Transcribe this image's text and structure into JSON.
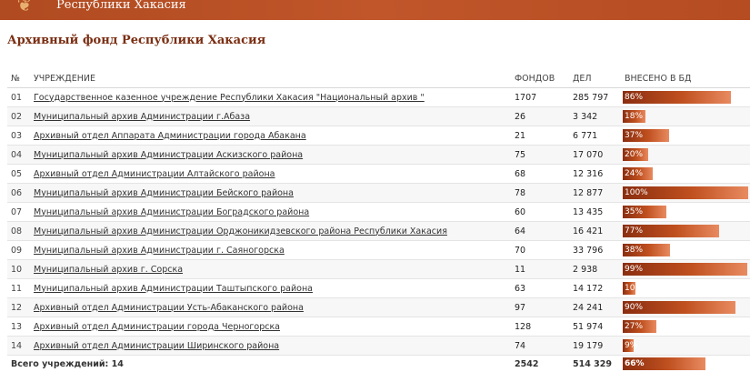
{
  "header": {
    "title": "Республики Хакасия",
    "logo_icon": "coat-of-arms-icon"
  },
  "page_title": "Архивный фонд Республики Хакасия",
  "table": {
    "columns": {
      "num": "№",
      "name": "УЧРЕЖДЕНИЕ",
      "funds": "ФОНДОВ",
      "cases": "ДЕЛ",
      "db": "ВНЕСЕНО В БД"
    },
    "rows": [
      {
        "num": "01",
        "name": "Государственное казенное учреждение Республики Хакасия \"Национальный архив \"",
        "funds": "1707",
        "cases": "285 797",
        "pct": "86%",
        "pct_value": 86
      },
      {
        "num": "02",
        "name": "Муниципальный архив Администрации г.Абаза",
        "funds": "26",
        "cases": "3 342",
        "pct": "18%",
        "pct_value": 18
      },
      {
        "num": "03",
        "name": "Архивный отдел Аппарата Администрации города Абакана",
        "funds": "21",
        "cases": "6 771",
        "pct": "37%",
        "pct_value": 37
      },
      {
        "num": "04",
        "name": "Муниципальный архив Администрации Аскизского района",
        "funds": "75",
        "cases": "17 070",
        "pct": "20%",
        "pct_value": 20
      },
      {
        "num": "05",
        "name": "Архивный отдел Администрации Алтайского района",
        "funds": "68",
        "cases": "12 316",
        "pct": "24%",
        "pct_value": 24
      },
      {
        "num": "06",
        "name": "Муниципальный архив Администрации Бейского района",
        "funds": "78",
        "cases": "12 877",
        "pct": "100%",
        "pct_value": 100
      },
      {
        "num": "07",
        "name": "Муниципальный архив Администрации Боградского района",
        "funds": "60",
        "cases": "13 435",
        "pct": "35%",
        "pct_value": 35
      },
      {
        "num": "08",
        "name": "Муниципальный архив Администрации Орджоникидзевского района Республики Хакасия",
        "funds": "64",
        "cases": "16 421",
        "pct": "77%",
        "pct_value": 77
      },
      {
        "num": "09",
        "name": "Муниципальный архив Администрации г. Саяногорска",
        "funds": "70",
        "cases": "33 796",
        "pct": "38%",
        "pct_value": 38
      },
      {
        "num": "10",
        "name": "Муниципальный архив г. Сорска",
        "funds": "11",
        "cases": "2 938",
        "pct": "99%",
        "pct_value": 99
      },
      {
        "num": "11",
        "name": "Муниципальный архив Администрации Таштыпского района",
        "funds": "63",
        "cases": "14 172",
        "pct": "10%",
        "pct_value": 10
      },
      {
        "num": "12",
        "name": "Архивный отдел Администрации Усть-Абаканского района",
        "funds": "97",
        "cases": "24 241",
        "pct": "90%",
        "pct_value": 90
      },
      {
        "num": "13",
        "name": "Архивный отдел Администрации города Черногорска",
        "funds": "128",
        "cases": "51 974",
        "pct": "27%",
        "pct_value": 27
      },
      {
        "num": "14",
        "name": "Архивный отдел Администрации Ширинского района",
        "funds": "74",
        "cases": "19 179",
        "pct": "9%",
        "pct_value": 9
      }
    ],
    "footer": {
      "label": "Всего учреждений: 14",
      "funds": "2542",
      "cases": "514 329",
      "pct": "66%",
      "pct_value": 66
    }
  }
}
